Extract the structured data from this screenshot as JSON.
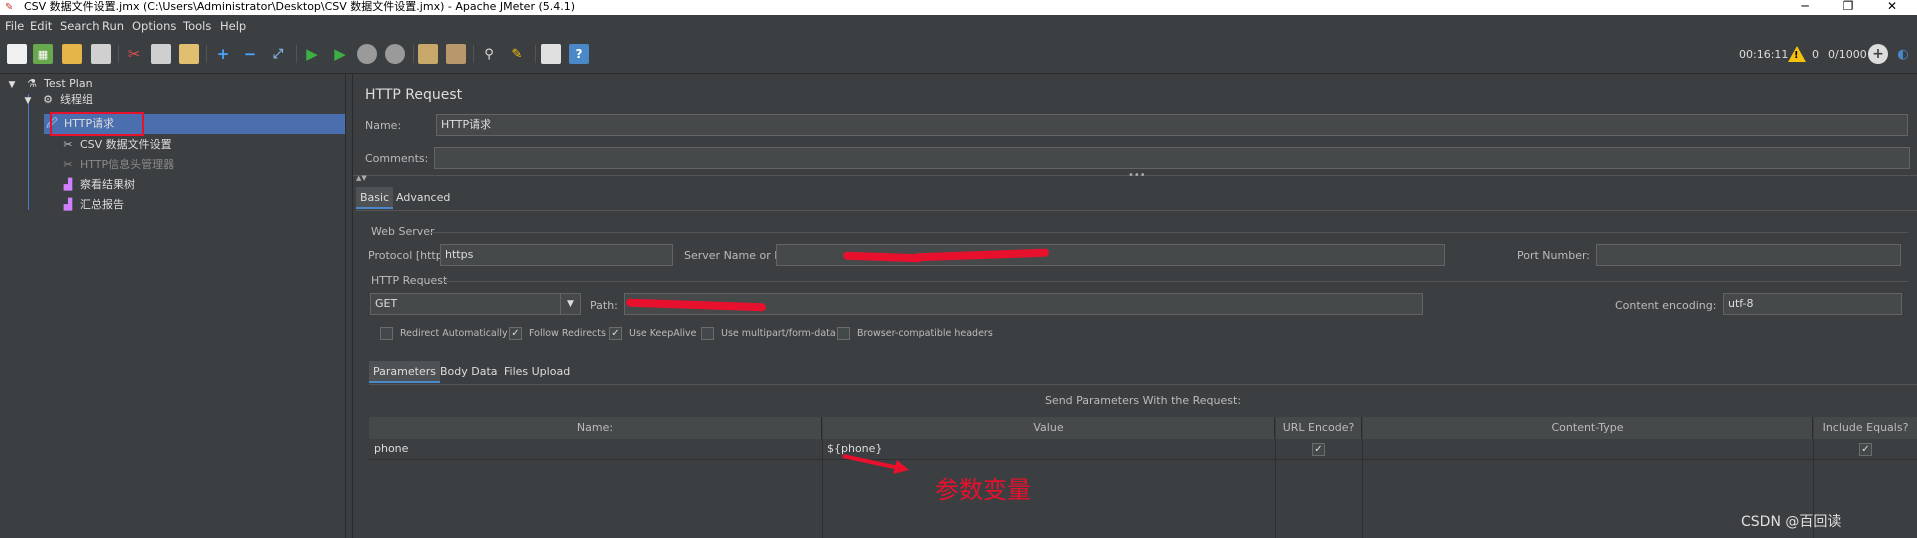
{
  "window": {
    "title": "CSV 数据文件设置.jmx (C:\\Users\\Administrator\\Desktop\\CSV 数据文件设置.jmx) - Apache JMeter (5.4.1)"
  },
  "menu": [
    "File",
    "Edit",
    "Search",
    "Run",
    "Options",
    "Tools",
    "Help"
  ],
  "status": {
    "elapsed": "00:16:11",
    "warnings": "0",
    "threads": "0/1000"
  },
  "tree": {
    "root": "Test Plan",
    "thread_group": "线程组",
    "items": [
      "HTTP请求",
      "CSV 数据文件设置",
      "HTTP信息头管理器",
      "察看结果树",
      "汇总报告"
    ]
  },
  "panel": {
    "heading": "HTTP Request",
    "name_label": "Name:",
    "name_value": "HTTP请求",
    "comments_label": "Comments:",
    "comments_value": "",
    "tabs": [
      "Basic",
      "Advanced"
    ]
  },
  "web_server": {
    "title": "Web Server",
    "protocol_label": "Protocol [http]:",
    "protocol_value": "https",
    "server_label": "Server Name or IP:",
    "port_label": "Port Number:",
    "port_value": ""
  },
  "http_request": {
    "title": "HTTP Request",
    "method": "GET",
    "path_label": "Path:",
    "encoding_label": "Content encoding:",
    "encoding_value": "utf-8"
  },
  "options": [
    {
      "label": "Redirect Automatically",
      "checked": false
    },
    {
      "label": "Follow Redirects",
      "checked": true
    },
    {
      "label": "Use KeepAlive",
      "checked": true
    },
    {
      "label": "Use multipart/form-data",
      "checked": false
    },
    {
      "label": "Browser-compatible headers",
      "checked": false
    }
  ],
  "param_tabs": [
    "Parameters",
    "Body Data",
    "Files Upload"
  ],
  "params_table": {
    "caption": "Send Parameters With the Request:",
    "headers": [
      "Name:",
      "Value",
      "URL Encode?",
      "Content-Type",
      "Include Equals?"
    ],
    "rows": [
      {
        "name": "phone",
        "value": "${phone}",
        "url_encode": true,
        "content_type": "",
        "include_equals": true
      }
    ]
  },
  "annotation": {
    "text": "参数变量"
  },
  "watermark": "CSDN @百回读",
  "colors": {
    "bg": "#3c3f41",
    "selected": "#4b6eaf",
    "annotation": "#e8112d",
    "highlight_box": "#e8112d"
  }
}
